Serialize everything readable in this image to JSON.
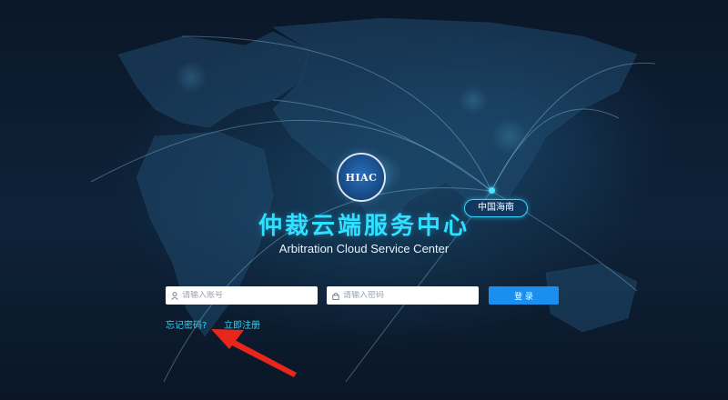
{
  "app": {
    "logo_text": "HIAC",
    "title": "仲裁云端服务中心",
    "subtitle": "Arbitration Cloud Service Center",
    "region_tag": "中国海南"
  },
  "login": {
    "account_placeholder": "请输入账号",
    "password_placeholder": "请输入密码",
    "login_button": "登 录",
    "forgot_password": "忘记密码?",
    "register": "立即注册"
  },
  "icons": {
    "account": "user-icon",
    "password": "lock-icon"
  },
  "colors": {
    "background": "#0c1a2e",
    "title": "#2fe0ff",
    "accent_button": "#1a8ff0",
    "link": "#31d2f2",
    "annotation_arrow": "#e8261c"
  }
}
